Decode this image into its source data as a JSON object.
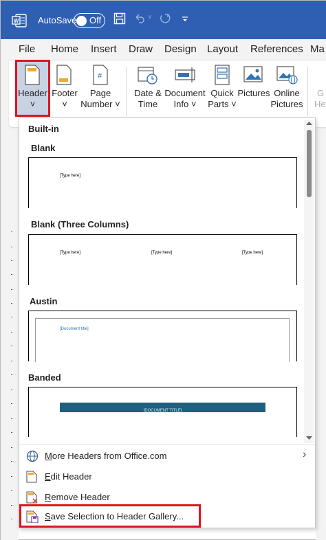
{
  "titlebar": {
    "autosave_label": "AutoSave",
    "toggle_label": "Off",
    "icons": [
      "word-logo",
      "save-icon",
      "undo-icon",
      "redo-icon",
      "customize-qat-icon"
    ]
  },
  "tabs": [
    "File",
    "Home",
    "Insert",
    "Draw",
    "Design",
    "Layout",
    "References",
    "Ma"
  ],
  "ribbon": {
    "header": {
      "line1": "Header",
      "line2": "˅"
    },
    "footer": {
      "line1": "Footer",
      "line2": "˅"
    },
    "page_number": {
      "line1": "Page",
      "line2": "Number ˅"
    },
    "date_time": {
      "line1": "Date &",
      "line2": "Time"
    },
    "document_info": {
      "line1": "Document",
      "line2": "Info ˅"
    },
    "quick_parts": {
      "line1": "Quick",
      "line2": "Parts ˅"
    },
    "pictures": {
      "line1": "Pictures",
      "line2": ""
    },
    "online_pictures": {
      "line1": "Online",
      "line2": "Pictures"
    },
    "cut_off": {
      "line1": "G",
      "line2": "He"
    }
  },
  "gallery": {
    "group_label": "Built-in",
    "items": [
      {
        "name": "Blank",
        "placeholders": [
          "[Type here]"
        ]
      },
      {
        "name": "Blank (Three Columns)",
        "placeholders": [
          "[Type here]",
          "[Type here]",
          "[Type here]"
        ]
      },
      {
        "name": "Austin",
        "placeholders": [
          "[Document title]"
        ]
      },
      {
        "name": "Banded",
        "placeholders": [
          "[DOCUMENT TITLE]"
        ]
      }
    ]
  },
  "menu": {
    "more_headers": {
      "first": "M",
      "rest": "ore Headers from Office.com"
    },
    "edit_header": {
      "first": "E",
      "rest": "dit Header"
    },
    "remove_header": {
      "first": "R",
      "rest": "emove Header"
    },
    "save_selection": {
      "first": "S",
      "rest": "ave Selection to Header Gallery..."
    }
  },
  "colors": {
    "titlebar": "#2f5fb3",
    "highlight": "#e0141e",
    "banded": "#1f5f7f",
    "austin_title": "#2e75b6"
  }
}
